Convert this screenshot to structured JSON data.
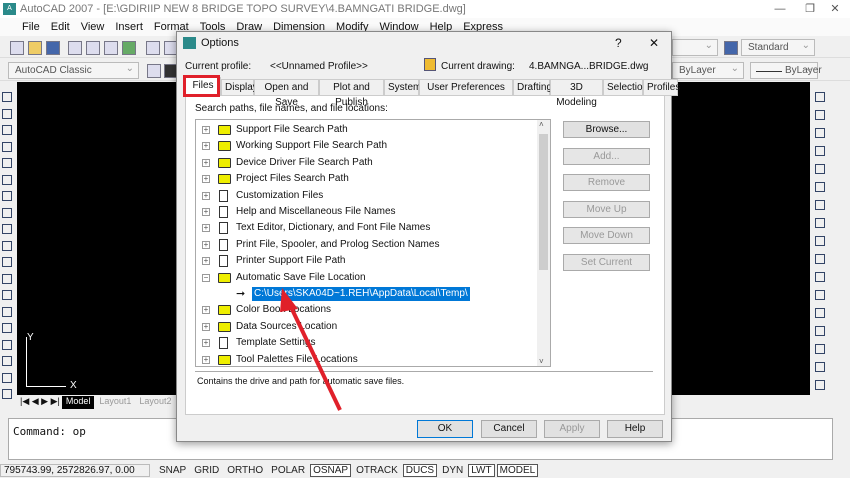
{
  "app": {
    "title": "AutoCAD 2007 - [E:\\GDIRIIP NEW 8 BRIDGE TOPO SURVEY\\4.BAMNGATI BRIDGE.dwg]",
    "icon_text": "A"
  },
  "menu": [
    "File",
    "Edit",
    "View",
    "Insert",
    "Format",
    "Tools",
    "Draw",
    "Dimension",
    "Modify",
    "Window",
    "Help",
    "Express"
  ],
  "toolbar": {
    "workspace": "AutoCAD Classic",
    "text_style": "Standard",
    "color": "ByLayer",
    "linetype": "ByLayer"
  },
  "layout_tabs": [
    "Model",
    "Layout1",
    "Layout2"
  ],
  "ucs": {
    "x": "X",
    "y": "Y"
  },
  "command": {
    "line": "Command: op"
  },
  "status": {
    "coords": "795743.99, 2572826.97, 0.00",
    "toggles": [
      {
        "label": "SNAP",
        "on": false
      },
      {
        "label": "GRID",
        "on": false
      },
      {
        "label": "ORTHO",
        "on": false
      },
      {
        "label": "POLAR",
        "on": false
      },
      {
        "label": "OSNAP",
        "on": true
      },
      {
        "label": "OTRACK",
        "on": false
      },
      {
        "label": "DUCS",
        "on": true
      },
      {
        "label": "DYN",
        "on": false
      },
      {
        "label": "LWT",
        "on": true
      },
      {
        "label": "MODEL",
        "on": true
      }
    ]
  },
  "dialog": {
    "title": "Options",
    "help": "?",
    "close": "✕",
    "profile_label": "Current profile:",
    "profile_value": "<<Unnamed Profile>>",
    "drawing_label": "Current drawing:",
    "drawing_value": "4.BAMNGA...BRIDGE.dwg",
    "tabs": [
      "Files",
      "Display",
      "Open and Save",
      "Plot and Publish",
      "System",
      "User Preferences",
      "Drafting",
      "3D Modeling",
      "Selection",
      "Profiles"
    ],
    "active_tab": "Files",
    "section_label": "Search paths, file names, and file locations:",
    "tree": [
      {
        "label": "Support File Search Path",
        "icon": "folder"
      },
      {
        "label": "Working Support File Search Path",
        "icon": "folder"
      },
      {
        "label": "Device Driver File Search Path",
        "icon": "folder"
      },
      {
        "label": "Project Files Search Path",
        "icon": "folder"
      },
      {
        "label": "Customization Files",
        "icon": "doc"
      },
      {
        "label": "Help and Miscellaneous File Names",
        "icon": "doc"
      },
      {
        "label": "Text Editor, Dictionary, and Font File Names",
        "icon": "doc"
      },
      {
        "label": "Print File, Spooler, and Prolog Section Names",
        "icon": "doc"
      },
      {
        "label": "Printer Support File Path",
        "icon": "doc"
      },
      {
        "label": "Automatic Save File Location",
        "icon": "folder",
        "expanded": true
      },
      {
        "label": "C:\\Users\\SKA04D~1.REH\\AppData\\Local\\Temp\\",
        "icon": "arrow",
        "selected": true,
        "child": true
      },
      {
        "label": "Color Book Locations",
        "icon": "folder"
      },
      {
        "label": "Data Sources Location",
        "icon": "folder"
      },
      {
        "label": "Template Settings",
        "icon": "doc"
      },
      {
        "label": "Tool Palettes File Locations",
        "icon": "folder"
      }
    ],
    "side_buttons": [
      {
        "label": "Browse...",
        "enabled": true
      },
      {
        "label": "Add...",
        "enabled": false
      },
      {
        "label": "Remove",
        "enabled": false
      },
      {
        "label": "Move Up",
        "enabled": false
      },
      {
        "label": "Move Down",
        "enabled": false
      },
      {
        "label": "Set Current",
        "enabled": false
      }
    ],
    "description": "Contains the drive and path for automatic save files.",
    "buttons": {
      "ok": "OK",
      "cancel": "Cancel",
      "apply": "Apply",
      "help": "Help"
    }
  },
  "colors": {
    "highlight": "#0078d7",
    "annotation_red": "#e0202a"
  }
}
